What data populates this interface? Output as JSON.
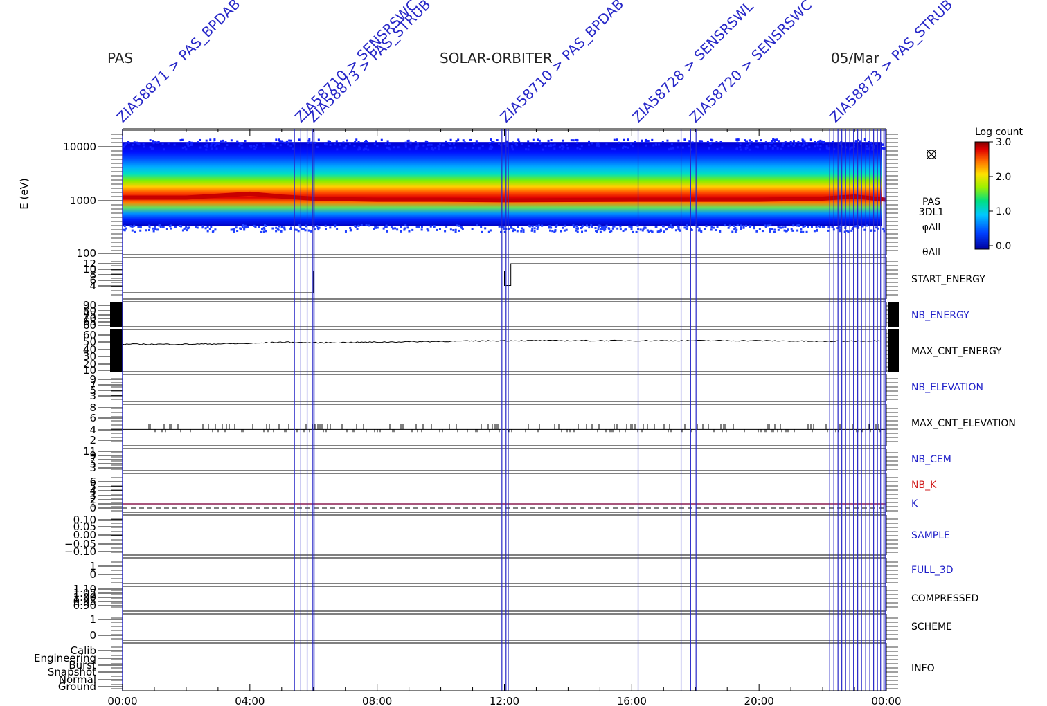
{
  "header": {
    "left": "PAS",
    "center": "SOLAR-ORBITER",
    "right": "05/Mar"
  },
  "colors": {
    "annotation": "#2828c8",
    "panel_label_blue": "#1e1ec8",
    "panel_label_red": "#d21e1e",
    "trace": "#000000",
    "k_line": "#8c1e50"
  },
  "annotations": [
    "ZIA58871 > PAS_BPDAB",
    "ZIA58710 > SENSRSWC",
    "ZIA58873 > PAS_STRUB",
    "ZIA58710 > PAS_BPDAB",
    "ZIA58728 > SENSRSWL",
    "ZIA58720 > SENSRSWC",
    "ZIA58873 > PAS_STRUB"
  ],
  "chart_data": [
    {
      "type": "heatmap",
      "title": "PAS",
      "ylabel": "E (eV)",
      "yscale": "log",
      "ylim": [
        100,
        20000
      ],
      "yticks": [
        "10000",
        "1000",
        "100"
      ],
      "panel_labels": [
        "PAS",
        "3DL1",
        "φAll",
        "θAll"
      ],
      "colorbar": {
        "label": "Log count",
        "ticks": [
          "3.0",
          "2.0",
          "1.0",
          "0.0"
        ],
        "range": [
          0.0,
          3.0
        ]
      },
      "peak_energy_eV": {
        "hours": [
          0,
          2,
          4,
          5,
          6,
          8,
          10,
          12,
          14,
          16,
          18,
          20,
          22,
          23,
          24
        ],
        "values": [
          1100,
          1100,
          1300,
          1150,
          1050,
          1000,
          1000,
          980,
          990,
          1000,
          1000,
          1000,
          1050,
          1150,
          1000
        ]
      }
    },
    {
      "type": "line",
      "title": "START_ENERGY",
      "yticks": [
        "12",
        "10",
        "8",
        "6",
        "4"
      ],
      "steps": {
        "hours": [
          0,
          6.0,
          12.0,
          12.2
        ],
        "values": [
          4,
          10,
          6,
          12
        ]
      }
    },
    {
      "type": "line",
      "title": "NB_ENERGY",
      "yticks": [
        "90",
        "80",
        "75",
        "70",
        "65",
        "60"
      ]
    },
    {
      "type": "line",
      "title": "MAX_CNT_ENERGY",
      "yticks": [
        "60",
        "50",
        "40",
        "30",
        "20",
        "10"
      ],
      "trace": {
        "hours": [
          0,
          2,
          4,
          5,
          6,
          8,
          10,
          12,
          14,
          16,
          18,
          20,
          22,
          24
        ],
        "values": [
          47,
          47,
          48,
          50,
          49,
          50,
          51,
          52,
          52,
          52,
          52,
          52,
          51,
          52
        ]
      }
    },
    {
      "type": "line",
      "title": "NB_ELEVATION",
      "yticks": [
        "9",
        "7",
        "5",
        "3",
        "0"
      ]
    },
    {
      "type": "line",
      "title": "MAX_CNT_ELEVATION",
      "yticks": [
        "8",
        "6",
        "4",
        "2"
      ],
      "baseline": 4
    },
    {
      "type": "line",
      "title": "NB_CEM",
      "yticks": [
        "11",
        "9",
        "7",
        "5",
        "3"
      ]
    },
    {
      "type": "line",
      "title": "NB_K",
      "yticks": [
        "6",
        "5",
        "4",
        "3",
        "2",
        "1",
        "0"
      ],
      "value": 1.5
    },
    {
      "type": "line",
      "title": "K",
      "value": 0
    },
    {
      "type": "line",
      "title": "SAMPLE",
      "yticks": [
        "0.10",
        "0.05",
        "0.00",
        "−0.05",
        "−0.10"
      ]
    },
    {
      "type": "line",
      "title": "FULL_3D",
      "yticks": [
        "1",
        "0"
      ]
    },
    {
      "type": "line",
      "title": "COMPRESSED",
      "yticks": [
        "1.10",
        "1.05",
        "1.00",
        "0.95",
        "0.90"
      ]
    },
    {
      "type": "line",
      "title": "SCHEME",
      "yticks": [
        "1",
        "0"
      ]
    },
    {
      "type": "line",
      "title": "INFO",
      "yticks": [
        "Calib",
        "Engineering",
        "Burst",
        "Snapshot",
        "Normal",
        "Ground"
      ]
    }
  ],
  "time_axis": {
    "ticks": [
      "00:00",
      "04:00",
      "08:00",
      "12:00",
      "16:00",
      "20:00",
      "00:00"
    ],
    "hours": [
      0,
      4,
      8,
      12,
      16,
      20,
      24
    ]
  },
  "event_markers_hours": [
    5.4,
    5.6,
    5.8,
    5.98,
    6.02,
    11.92,
    12.05,
    12.12,
    16.2,
    17.55,
    17.85,
    18.02,
    22.22,
    22.35,
    22.48,
    22.6,
    22.72,
    22.85,
    22.97,
    23.1,
    23.22,
    23.35,
    23.48,
    23.6,
    23.72,
    23.82,
    23.92,
    23.96
  ],
  "icons": {
    "corner": "cross-circle-icon"
  }
}
